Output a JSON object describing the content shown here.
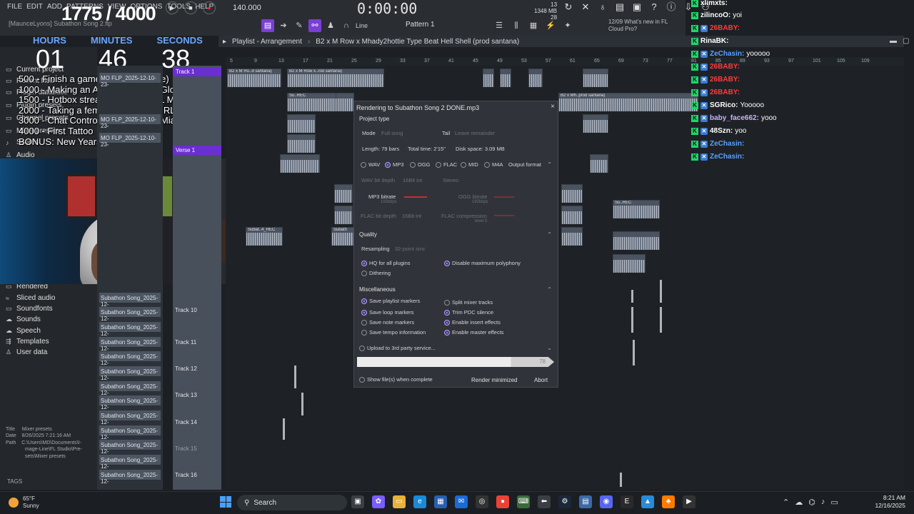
{
  "menu": [
    "FILE",
    "EDIT",
    "ADD",
    "PATTERNS",
    "VIEW",
    "OPTIONS",
    "TOOLS",
    "HELP"
  ],
  "project_title": "[MaunceLyons] Subathon Song 2.flp",
  "overlay": {
    "counter": "1775 / 4000",
    "timer_labels": {
      "hours": "HOURS",
      "minutes": "MINUTES",
      "seconds": "SECONDS"
    },
    "timer": {
      "hours": "01",
      "minutes": "46",
      "seconds": "38"
    },
    "goals": [
      "500 - Finish a game (Viewer Choice)",
      "1000 - Making an Album wit GlizzyGlo (Desktop)",
      "1500 - Hotbox stream w Guest (IRL Miami)",
      "2000 - Taking a female on a Date (IRL Miami)",
      "3000 - Chat Controls My Day (IRL Miami)",
      "4000 - First Tattoo",
      "BONUS: New Years in New York!"
    ]
  },
  "transport": {
    "tempo": "140.000",
    "time": "0:00:00",
    "pattern": "Pattern 1",
    "snap": "Line",
    "cpu": "13",
    "ram": "1348 MB",
    "ram_sub": "28"
  },
  "news": {
    "date": "12/09",
    "line1": "What's new in FL",
    "line2": "Cloud Pro?"
  },
  "playlist": {
    "title": "Playlist - Arrangement",
    "breadcrumb": "B2 x M Row x Mhady2hottie Type Beat Hell Shell (prod santana)",
    "ruler": [
      "5",
      "9",
      "13",
      "17",
      "21",
      "25",
      "29",
      "33",
      "37",
      "41",
      "45",
      "49",
      "53",
      "57",
      "61",
      "65",
      "69",
      "73",
      "77",
      "81",
      "85",
      "89",
      "93",
      "97",
      "101",
      "105",
      "109"
    ],
    "clip_labels": [
      "B2 x M Ro..d santana)",
      "B2 x M Row x..rod santana)",
      "Su..REC",
      "Subat..4_REC",
      "Subath",
      "B..na)",
      "B2 x M R..santana)",
      "B2 x Mh..prod santana)",
      "Su..REC"
    ]
  },
  "browser": {
    "items": [
      "Current project",
      "Recent files",
      "Plugin database",
      "Plugin presets",
      "Channel presets",
      "Mixer presets",
      "Scores",
      "Audio",
      "Rendered",
      "Sliced audio",
      "Soundfonts",
      "Sounds",
      "Speech",
      "Templates",
      "User data"
    ],
    "file_info": {
      "title_label": "Title",
      "title": "Mixer presets",
      "date_label": "Date",
      "date": "8/26/2025 7:21:16 AM",
      "path_label": "Path",
      "path1": "C:\\Users\\MD\\Documents\\I-",
      "path2": "mage-Line\\FL Studio\\Pre-",
      "path3": "sets\\Mixer presets"
    },
    "tags": "TAGS"
  },
  "channels": {
    "top": [
      "MO FLP_2025-12-10-23-",
      "MO FLP_2025-12-10-23-",
      "MO FLP_2025-12-10-23-"
    ],
    "list": [
      "Subathon Song_2025-12-",
      "Subathon Song_2025-12-",
      "Subathon Song_2025-12-",
      "Subathon Song_2025-12-",
      "Subathon Song_2025-12-",
      "Subathon Song_2025-12-",
      "Subathon Song_2025-12-",
      "Subathon Song_2025-12-",
      "Subathon Song_2025-12-",
      "Subathon Song_2025-12-",
      "Subathon Song_2025-12-",
      "Subathon Song_2025-12-",
      "Subathon Song_2025-12-"
    ]
  },
  "tracks": {
    "t1": "Track 1",
    "verse": "Verse 1",
    "t10": "Track 10",
    "t11": "Track 11",
    "t12": "Track 12",
    "t13": "Track 13",
    "t14": "Track 14",
    "t15": "Track 15",
    "t16": "Track 16"
  },
  "render": {
    "title": "Rendering to Subathon Song 2 DONE.mp3",
    "project_type": "Project type",
    "mode_label": "Mode",
    "mode_value": "Full song",
    "tail_label": "Tail",
    "tail_value": "Leave remainder",
    "length": "Length: 79 bars",
    "total_time": "Total time: 2'15\"",
    "disk_space": "Disk space: 3.09 MB",
    "formats": [
      "WAV",
      "MP3",
      "OGG",
      "FLAC",
      "MID",
      "M4A"
    ],
    "selected_format": "MP3",
    "output_format": "Output format",
    "wav_bit_depth": "WAV bit depth",
    "wav_bit_value": "16Bit int",
    "stereo": "Stereo",
    "mp3_bitrate": "MP3 bitrate",
    "mp3_value": "192kbps",
    "ogg_bitrate": "OGG bitrate",
    "ogg_value": "192kbps",
    "flac_bit_depth": "FLAC bit depth",
    "flac_bit_value": "16Bit int",
    "flac_compression": "FLAC compression",
    "flac_comp_value": "level 5",
    "quality": "Quality",
    "resampling": "Resampling",
    "resampling_value": "32-point sinc",
    "hq_plugins": "HQ for all plugins",
    "disable_poly": "Disable maximum polyphony",
    "dithering": "Dithering",
    "misc": "Miscellaneous",
    "save_playlist_markers": "Save playlist markers",
    "split_mixer": "Split mixer tracks",
    "save_loop_markers": "Save loop markers",
    "trim_pdc": "Trim PDC silence",
    "save_note_markers": "Save note markers",
    "enable_insert": "Enable insert effects",
    "save_tempo": "Save tempo information",
    "enable_master": "Enable master effects",
    "upload": "Upload to 3rd party service...",
    "progress": 78,
    "progress_label": "78",
    "show_files": "Show file(s) when complete",
    "render_minimized": "Render minimized",
    "abort": "Abort"
  },
  "chat": [
    {
      "name": "xlimxts:",
      "text": "",
      "color": "#ffffff",
      "badge2": false
    },
    {
      "name": "zilincoO:",
      "text": "yoi",
      "color": "#ffffff",
      "badge2": false
    },
    {
      "name": "26BABY:",
      "text": "",
      "color": "#ff3b3b",
      "badge2": true
    },
    {
      "name": "RinaBK:",
      "text": "",
      "color": "#ffffff",
      "badge2": false
    },
    {
      "name": "ZeChasin:",
      "text": "yooooo",
      "color": "#5aa0ff",
      "badge2": true
    },
    {
      "name": "26BABY:",
      "text": "",
      "color": "#ff3b3b",
      "badge2": true
    },
    {
      "name": "26BABY:",
      "text": "",
      "color": "#ff3b3b",
      "badge2": true
    },
    {
      "name": "26BABY:",
      "text": "",
      "color": "#ff3b3b",
      "badge2": true
    },
    {
      "name": "SGRico:",
      "text": "Yooooo",
      "color": "#ffffff",
      "badge2": true
    },
    {
      "name": "baby_face662:",
      "text": "yooo",
      "color": "#c9b0ff",
      "badge2": true
    },
    {
      "name": "48Szn:",
      "text": "yoo",
      "color": "#ffffff",
      "badge2": true
    },
    {
      "name": "ZeChasin:",
      "text": "",
      "color": "#5aa0ff",
      "badge2": true
    },
    {
      "name": "ZeChasin:",
      "text": "",
      "color": "#5aa0ff",
      "badge2": true
    }
  ],
  "taskbar": {
    "temp": "65°F",
    "weather": "Sunny",
    "search": "Search",
    "time": "8:21 AM",
    "date": "12/16/2025"
  },
  "colors": {
    "accent": "#7a3fd6",
    "track_highlight": "#6a2fd0",
    "timer_label": "#6aa6ff"
  }
}
